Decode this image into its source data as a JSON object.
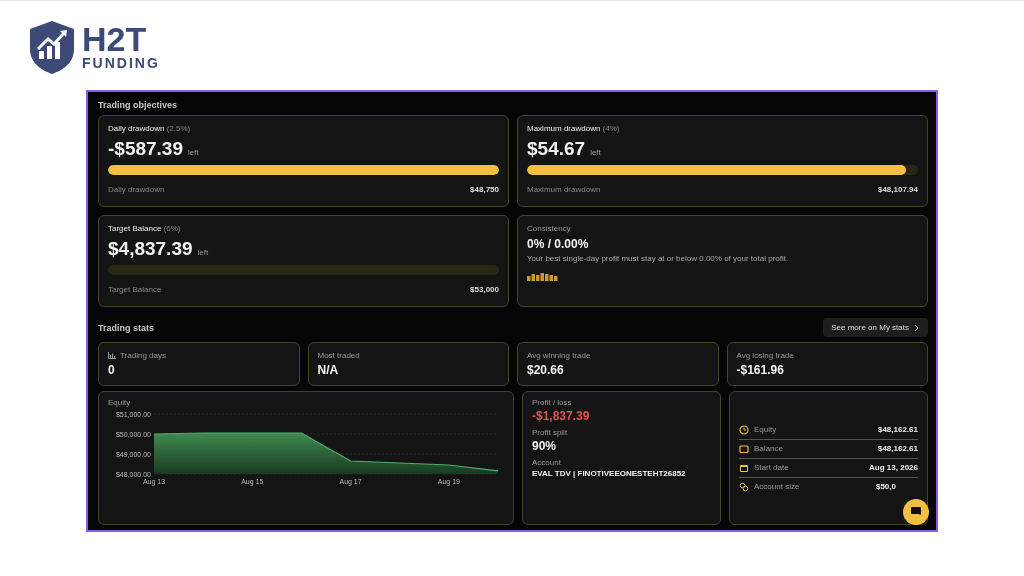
{
  "brand": {
    "name": "H2T",
    "tagline": "FUNDING"
  },
  "objectives": {
    "title": "Trading objectives",
    "cards": [
      {
        "kind": "progress",
        "title": "Daily drawdown",
        "note": "(2.5%)",
        "amount": "-$587.39",
        "suffix": "left",
        "level": 1.0,
        "footer_label": "Daily drawdown",
        "footer_value": "$48,750"
      },
      {
        "kind": "progress",
        "title": "Maximum drawdown",
        "note": "(4%)",
        "amount": "$54.67",
        "suffix": "left",
        "level": 0.97,
        "footer_label": "Maximum drawdown",
        "footer_value": "$48,107.94"
      },
      {
        "kind": "progress",
        "title": "Target Balance",
        "note": "(6%)",
        "amount": "$4,837.39",
        "suffix": "left",
        "level": 0,
        "footer_label": "Target Balance",
        "footer_value": "$53,000"
      },
      {
        "kind": "consistency",
        "title": "Consistency",
        "amount": "0% / 0.00%",
        "description": "Your best single-day profit must stay at or below 0.00% of your total profit."
      }
    ]
  },
  "stats": {
    "title": "Trading stats",
    "more_button": "See more on My stats",
    "tiles": [
      {
        "label": "Trading days",
        "value": "0",
        "icon": true
      },
      {
        "label": "Most traded",
        "value": "N/A",
        "icon": false
      },
      {
        "label": "Avg winning trade",
        "value": "$20.66",
        "icon": false
      },
      {
        "label": "Avg losing trade",
        "value": "-$161.96",
        "icon": false
      }
    ],
    "equity": {
      "chart_data": {
        "type": "area",
        "title": "Equity",
        "categories": [
          "Aug 13",
          null,
          "Aug 15",
          null,
          "Aug 17",
          null,
          "Aug 19",
          null
        ],
        "series": [
          {
            "color": "#4caf6a",
            "values": [
              50000,
              50050,
              50050,
              50050,
              48650,
              48550,
              48450,
              48160
            ]
          }
        ],
        "ylim": [
          48000,
          51000
        ],
        "yticks": [
          {
            "value": 48000,
            "label": "$48,000.00"
          },
          {
            "value": 49000,
            "label": "$49,000.00"
          },
          {
            "value": 50000,
            "label": "$50,000.00"
          },
          {
            "value": 51000,
            "label": "$51,000.00"
          }
        ]
      }
    },
    "profit": [
      {
        "kind": "amount",
        "label": "Profit / loss",
        "value": "-$1,837.39",
        "negative": true
      },
      {
        "kind": "amount",
        "label": "Profit split",
        "value": "90%",
        "negative": false
      },
      {
        "kind": "text",
        "label": "Account",
        "value": "EVAL TDV | FINOTIVEEONESTEHT26852",
        "negative": false
      }
    ],
    "account": [
      {
        "kind": "clock",
        "label": "Equity",
        "value": "$48,162.61"
      },
      {
        "kind": "wallet",
        "label": "Balance",
        "value": "$48,162.61"
      },
      {
        "kind": "calendar",
        "label": "Start date",
        "value": "Aug 13, 2026"
      },
      {
        "kind": "coins",
        "label": "Account size",
        "value": "$50,0"
      }
    ]
  }
}
